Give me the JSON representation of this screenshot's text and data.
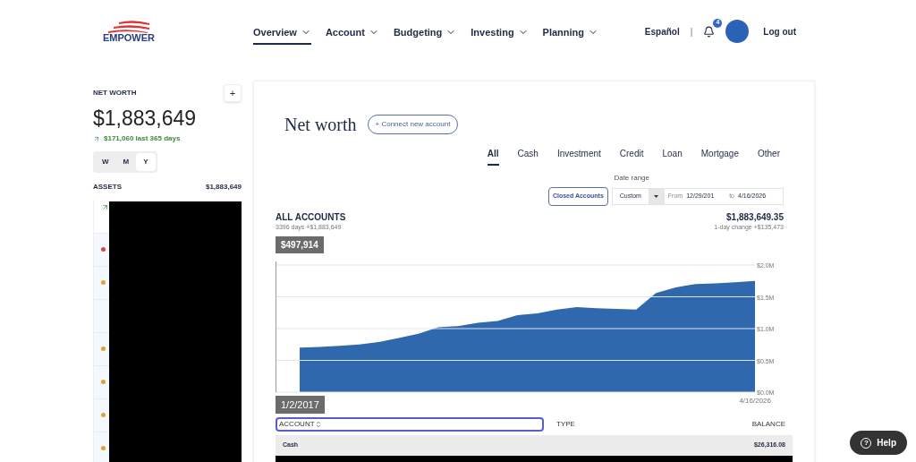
{
  "header": {
    "logo": "EMPOWER",
    "nav": [
      {
        "label": "Overview",
        "selected": true
      },
      {
        "label": "Account",
        "selected": false
      },
      {
        "label": "Budgeting",
        "selected": false
      },
      {
        "label": "Investing",
        "selected": false
      },
      {
        "label": "Planning",
        "selected": false
      }
    ],
    "language": "Español",
    "separator": "|",
    "notifications": "4",
    "logout": "Log out"
  },
  "sidebar": {
    "title": "NET WORTH",
    "add": "+",
    "value": "$1,883,649",
    "change": "$171,060 last 365 days",
    "periods": [
      {
        "label": "W",
        "selected": false
      },
      {
        "label": "M",
        "selected": false
      },
      {
        "label": "Y",
        "selected": true
      }
    ],
    "assets_label": "ASSETS",
    "assets_value": "$1,883,649",
    "accounts": [
      {
        "kind": "trend"
      },
      {
        "kind": "dot",
        "color": "#d64545"
      },
      {
        "kind": "dot",
        "color": "#e0a436"
      },
      {
        "kind": "empty"
      },
      {
        "kind": "dot",
        "color": "#e0a436"
      },
      {
        "kind": "dot",
        "color": "#e0a436"
      },
      {
        "kind": "dot",
        "color": "#e0a436"
      },
      {
        "kind": "dot",
        "color": "#e0a436"
      }
    ]
  },
  "main": {
    "title": "Net worth",
    "connect": "+ Connect new account",
    "tabs": [
      {
        "label": "All",
        "selected": true
      },
      {
        "label": "Cash",
        "selected": false
      },
      {
        "label": "Investment",
        "selected": false
      },
      {
        "label": "Credit",
        "selected": false
      },
      {
        "label": "Loan",
        "selected": false
      },
      {
        "label": "Mortgage",
        "selected": false
      },
      {
        "label": "Other",
        "selected": false
      }
    ],
    "date_range_label": "Date range",
    "closed_accounts": "Closed Accounts",
    "range_select": "Custom",
    "from_label": "From",
    "from": "12/29/201",
    "to_label": "to",
    "to": "4/16/2026",
    "summary_title": "ALL ACCOUNTS",
    "summary_sub": "3396 days +$1,883,649",
    "total": "$1,883,649.35",
    "day_change": "1-day change +$135,473",
    "tooltip_value": "$497,914",
    "chart_data": {
      "type": "area",
      "categories": [
        "1/2/2017",
        null,
        null,
        null,
        null,
        null,
        null,
        null,
        null,
        null,
        null,
        null,
        null,
        null,
        null,
        null,
        null,
        null,
        null,
        null,
        null,
        null,
        null,
        "4/16/2026"
      ],
      "series": [
        {
          "color": "#2f68ad",
          "values": [
            0.7,
            0.71,
            0.73,
            0.75,
            0.79,
            0.85,
            0.92,
            1.02,
            1.04,
            1.09,
            1.12,
            1.21,
            1.24,
            1.3,
            1.34,
            1.32,
            1.31,
            1.3,
            1.56,
            1.65,
            1.7,
            1.71,
            1.73,
            1.75
          ]
        }
      ],
      "ylim": [
        0,
        2
      ],
      "grid": true,
      "yticks": [
        {
          "value": 0,
          "label": "$0.0M"
        },
        {
          "value": 0.5,
          "label": "$0.5M"
        },
        {
          "value": 1,
          "label": "$1.0M"
        },
        {
          "value": 1.5,
          "label": "$1.5M"
        },
        {
          "value": 2,
          "label": "$2.0M"
        }
      ]
    },
    "table": {
      "columns": [
        "ACCOUNT",
        "TYPE",
        "BALANCE"
      ],
      "groups": [
        {
          "name": "Cash",
          "balance": "$26,316.08"
        }
      ]
    }
  },
  "help": "Help",
  "help_icon": "?"
}
